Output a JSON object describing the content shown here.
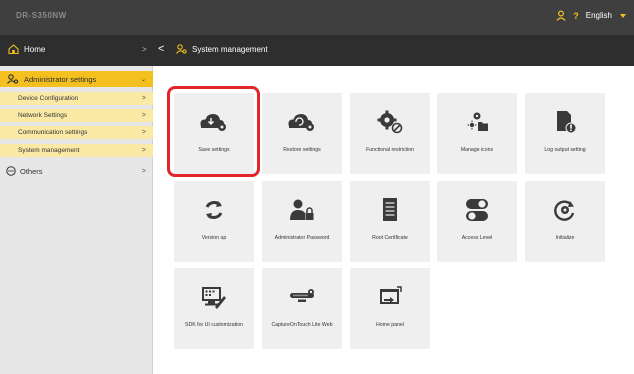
{
  "header": {
    "model": "DR-S350NW",
    "help": "?",
    "language": "English"
  },
  "nav": {
    "home": "Home",
    "home_chevron": ">",
    "back": "<",
    "breadcrumb": "System management"
  },
  "sidebar": {
    "admin": "Administrator settings",
    "admin_chevron": "⌄",
    "items": [
      {
        "label": "Device Configuration",
        "chevron": ">"
      },
      {
        "label": "Network Settings",
        "chevron": ">"
      },
      {
        "label": "Communication settings",
        "chevron": ">"
      },
      {
        "label": "System management",
        "chevron": ">"
      }
    ],
    "others": "Others",
    "others_chevron": ">"
  },
  "tiles": [
    {
      "label": "Save settings",
      "icon": "cloud-download-gear-icon"
    },
    {
      "label": "Restore settings",
      "icon": "cloud-restore-gear-icon"
    },
    {
      "label": "Functional restriction",
      "icon": "gears-forbidden-icon"
    },
    {
      "label": "Manage icons",
      "icon": "gear-folder-icon"
    },
    {
      "label": "Log output setting",
      "icon": "document-alert-icon"
    },
    {
      "label": "Version up",
      "icon": "refresh-icon"
    },
    {
      "label": "Administrator Password",
      "icon": "user-lock-icon"
    },
    {
      "label": "Root Certificate",
      "icon": "document-list-icon"
    },
    {
      "label": "Access Level",
      "icon": "toggle-switches-icon"
    },
    {
      "label": "Initialize",
      "icon": "reset-gear-icon"
    },
    {
      "label": "SDK for UI customization",
      "icon": "monitor-tools-icon"
    },
    {
      "label": "CaptureOnTouch Lite Web",
      "icon": "capture-app-icon"
    },
    {
      "label": "Home panel",
      "icon": "window-swap-icon"
    }
  ],
  "colors": {
    "accent": "#f3c01f",
    "highlight": "#e0262b",
    "topbar": "#3f3f3f",
    "navbar": "#2e2e2e",
    "icon": "#3a3a3a"
  }
}
